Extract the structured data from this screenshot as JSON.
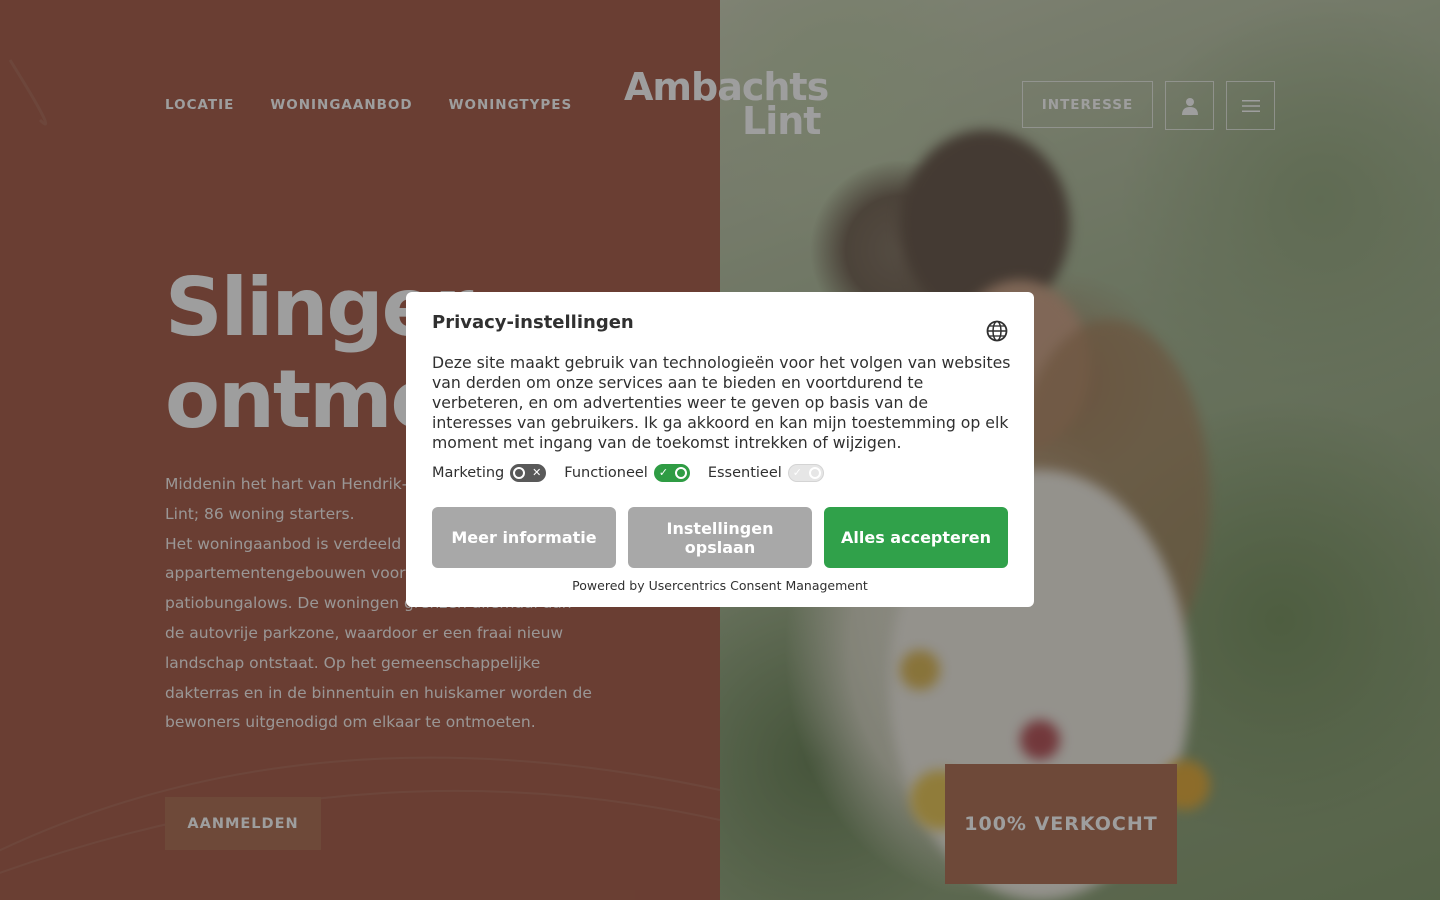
{
  "site": {
    "logo_line1": "Ambachts",
    "logo_line2": "Lint",
    "nav": [
      {
        "label": "LOCATIE"
      },
      {
        "label": "WONINGAANBOD"
      },
      {
        "label": "WONINGTYPES"
      }
    ],
    "interest_label": "INTERESSE",
    "user_icon": "user-icon",
    "menu_icon": "hamburger-menu-icon"
  },
  "hero": {
    "title_line1": "Slinger",
    "title_line2": "ontmo",
    "paragraph1": "Middenin het hart van Hendrik-Ido project Ambachts Lint; 86 woning starters.",
    "paragraph2": "Het woningaanbod is verdeeld ov appartementengebouwen voor st aantrekkelijke patiobungalows. De woningen grenzen allemaal aan de autovrije parkzone, waardoor er een fraai nieuw landschap ontstaat. Op het gemeenschappelijke dakterras en in de binnentuin en huiskamer worden de bewoners uitgenodigd om elkaar te ontmoeten.",
    "signup_label": "AANMELDEN",
    "sold_label": "100% VERKOCHT"
  },
  "consent": {
    "title": "Privacy-instellingen",
    "language_icon": "globe-icon",
    "body": "Deze site maakt gebruik van technologieën voor het volgen van websites van derden om onze services aan te bieden en voortdurend te verbeteren, en om advertenties weer te geven op basis van de interesses van gebruikers. Ik ga akkoord en kan mijn toestemming op elk moment met ingang van de toekomst intrekken of wijzigen.",
    "toggles": [
      {
        "label": "Marketing",
        "state": "off"
      },
      {
        "label": "Functioneel",
        "state": "on"
      },
      {
        "label": "Essentieel",
        "state": "on-disabled"
      }
    ],
    "more_info_label": "Meer informatie",
    "save_label": "Instellingen opslaan",
    "accept_label": "Alles accepteren",
    "powered_by": "Powered by Usercentrics Consent Management"
  },
  "colors": {
    "brand_brown": "#a0513c",
    "button_brown": "#a86447",
    "accept_green": "#30a14a",
    "neutral_button": "#a8a8a8"
  }
}
